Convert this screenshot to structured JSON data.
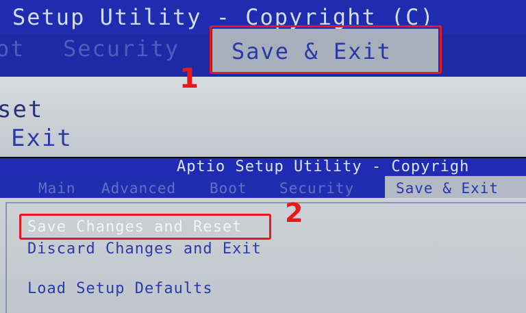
{
  "top": {
    "title": "Setup Utility - Copyright (C)",
    "tabs": [
      "ot",
      "Security",
      "Save & Exit"
    ],
    "items": [
      "set",
      "Exit"
    ],
    "marker": "1"
  },
  "bottom": {
    "title": "Aptio Setup Utility - Copyrigh",
    "tabs": [
      "Main",
      "Advanced",
      "Boot",
      "Security",
      "Save & Exit"
    ],
    "items": [
      "Save Changes and Reset",
      "Discard Changes and Exit",
      "Load Setup Defaults"
    ],
    "marker": "2"
  },
  "colors": {
    "bios_blue": "#1f2cb0",
    "menu_text": "#2a38a6",
    "highlight_red": "#e8191c",
    "panel_gray": "#c9cfd6"
  }
}
